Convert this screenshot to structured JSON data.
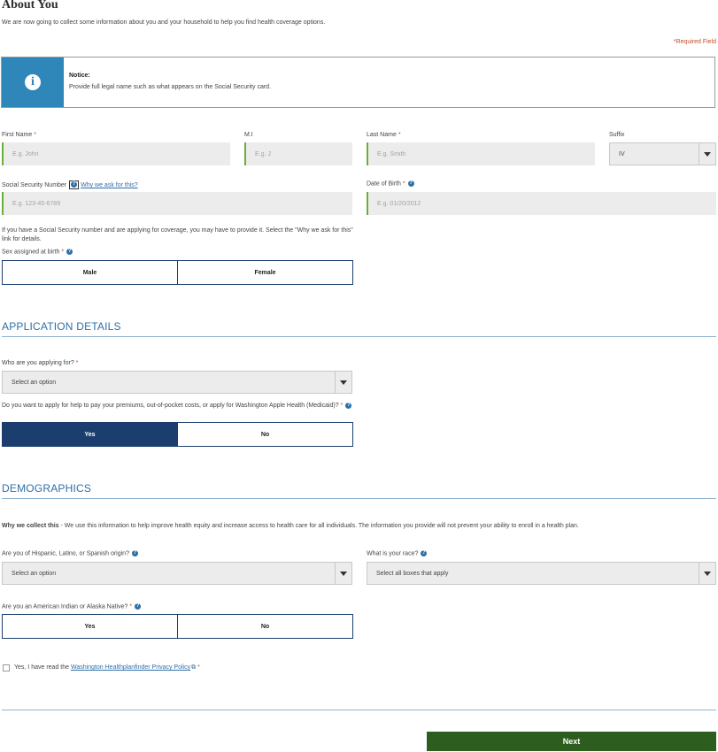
{
  "page": {
    "title": "About You",
    "intro": "We are now going to collect some information about you and your household to help you find health coverage options.",
    "required_legend": "*Required Field",
    "required_mark": "*"
  },
  "notice": {
    "icon": "info-icon",
    "title": "Notice:",
    "text": "Provide full legal name such as what appears on the Social Security card."
  },
  "about": {
    "first_name": {
      "label": "First Name",
      "placeholder": "E.g. John"
    },
    "mi": {
      "label": "M.I",
      "placeholder": "E.g. J"
    },
    "last_name": {
      "label": "Last Name",
      "placeholder": "E.g. Smith"
    },
    "suffix": {
      "label": "Suffix",
      "value": "IV"
    },
    "ssn": {
      "label": "Social Security Number",
      "why_link": "Why we ask for this?",
      "placeholder": "E.g. 123-45-6789"
    },
    "dob": {
      "label": "Date of Birth",
      "placeholder": "E.g. 01/20/2012"
    },
    "ssn_helper": "If you have a Social Security number and are applying for coverage, you may have to provide it. Select the \"Why we ask for this\" link for details.",
    "sex": {
      "label": "Sex assigned at birth",
      "options": [
        "Male",
        "Female"
      ]
    }
  },
  "application": {
    "heading": "APPLICATION DETAILS",
    "applying_for": {
      "label": "Who are you applying for?",
      "value": "Select an option"
    },
    "help_question": {
      "label": "Do you want to apply for help to pay your premiums, out-of-pocket costs, or apply for Washington Apple Health (Medicaid)?",
      "options": [
        "Yes",
        "No"
      ],
      "selected": "Yes"
    }
  },
  "demographics": {
    "heading": "DEMOGRAPHICS",
    "why_bold": "Why we collect this",
    "why_text": " - We use this information to help improve health equity and increase access to health care for all individuals. The information you provide will not prevent your ability to enroll in a health plan.",
    "hispanic": {
      "label": "Are you of Hispanic, Latino, or Spanish origin?",
      "value": "Select an option"
    },
    "race": {
      "label": "What is your race?",
      "value": "Select all boxes that apply"
    },
    "native": {
      "label": "Are you an American Indian or Alaska Native?",
      "options": [
        "Yes",
        "No"
      ]
    }
  },
  "privacy": {
    "prefix": "Yes, I have read the ",
    "link": "Washington Healthplanfinder Privacy Policy"
  },
  "footer": {
    "next_label": "Next"
  },
  "colors": {
    "accent_blue": "#2e6fa8",
    "notice_blue": "#2e86b9",
    "toggle_navy": "#1c3e6e",
    "next_green": "#2d5e1f",
    "required_red": "#c0502a",
    "input_green": "#6cae3b"
  }
}
